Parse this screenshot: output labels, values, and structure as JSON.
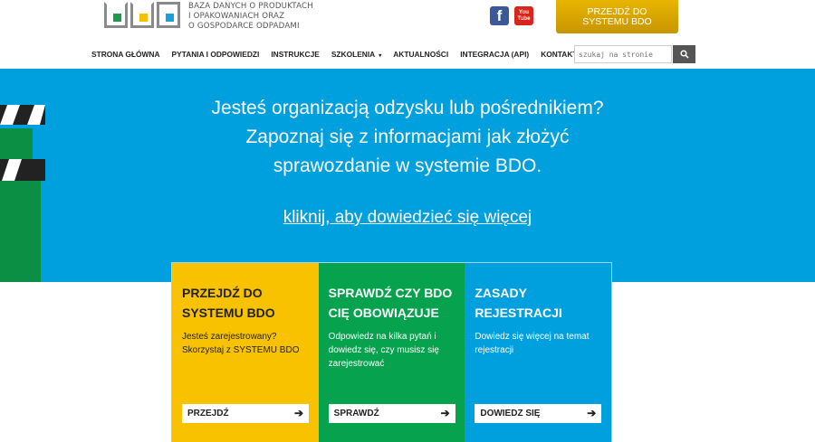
{
  "header": {
    "tagline": [
      "BAZA DANYCH O PRODUKTACH",
      "I OPAKOWANIACH ORAZ",
      "O GOSPODARCE ODPADAMI"
    ],
    "social": {
      "facebook": "f",
      "youtube": [
        "You",
        "Tube"
      ]
    },
    "cta": [
      "PRZEJDŹ DO",
      "SYSTEMU BDO"
    ],
    "search_placeholder": "szukaj na stronie",
    "colors": {
      "logo_green": "#1a9c4a",
      "logo_yellow": "#f4c000",
      "logo_blue": "#1a9fdb",
      "cta": "#d9a800"
    }
  },
  "nav": {
    "items": [
      "STRONA GŁÓWNA",
      "PYTANIA I ODPOWIEDZI",
      "INSTRUKCJE",
      "SZKOLENIA",
      "AKTUALNOŚCI",
      "INTEGRACJA (API)",
      "KONTAKT"
    ],
    "caret": "▾"
  },
  "hero": {
    "lines": [
      "Jesteś organizacją odzysku lub pośrednikiem?",
      "Zapoznaj się z informacjami jak złożyć",
      "sprawozdanie w systemie BDO."
    ],
    "link": "kliknij, aby dowiedzieć się więcej",
    "background": "#009fdd"
  },
  "cards": [
    {
      "title": [
        "PRZEJDŹ DO",
        "SYSTEMU BDO"
      ],
      "desc": "Jesteś zarejestrowany? Skorzystaj z SYSTEMU BDO",
      "button": "PRZEJDŹ",
      "color": "#f8c200"
    },
    {
      "title": [
        "SPRAWDŹ CZY BDO",
        "CIĘ OBOWIĄZUJE"
      ],
      "desc": "Odpowiedz na kilka pytań i dowiedz się, czy musisz się zarejestrować",
      "button": "SPRAWDŹ",
      "color": "#06a24e"
    },
    {
      "title": [
        "ZASADY",
        "REJESTRACJI"
      ],
      "desc": "Dowiedz się więcej na temat rejestracji",
      "button": "DOWIEDZ SIĘ",
      "color": "#009fdd"
    }
  ]
}
